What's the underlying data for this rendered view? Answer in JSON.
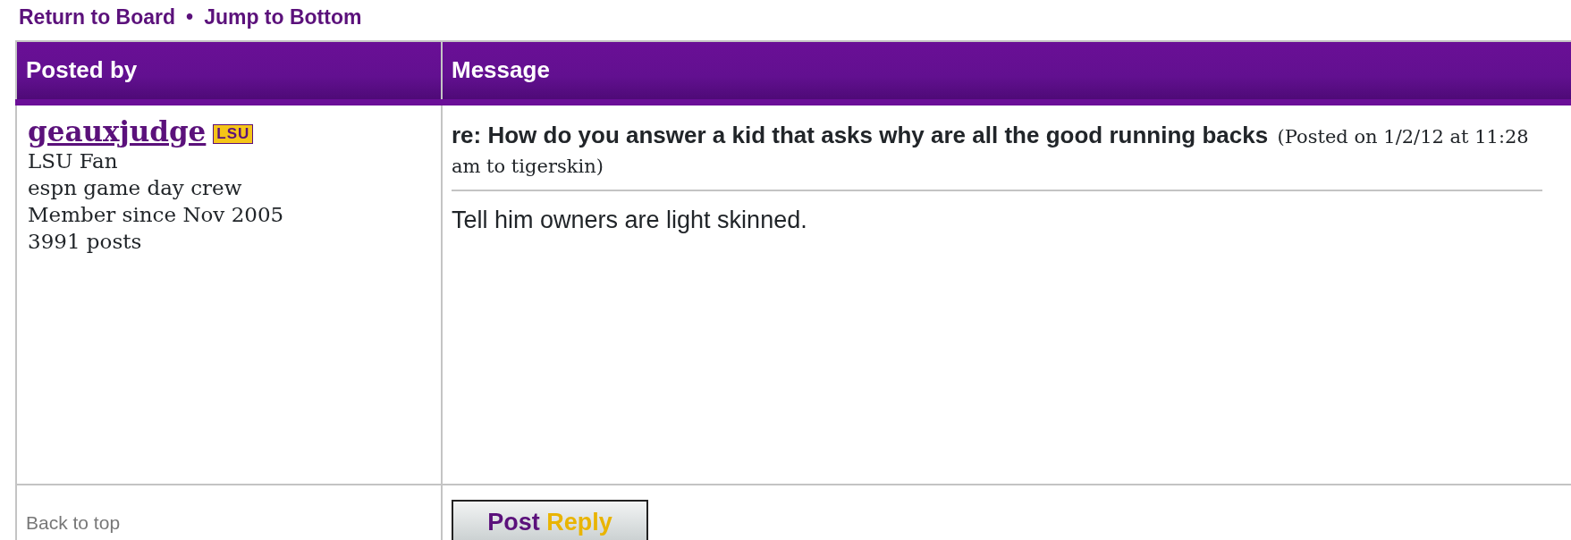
{
  "nav_links": [
    "Return to Board",
    "Jump to Bottom"
  ],
  "nav_separator": "•",
  "columns": [
    "Posted by",
    "Message"
  ],
  "post": {
    "author": "geauxjudge",
    "team_badge": "LSU",
    "author_lines": [
      "LSU Fan",
      "espn game day crew",
      "Member since Nov 2005",
      "3991 posts"
    ],
    "title": "re: How do you answer a kid that asks why are all the good running backs",
    "meta": "(Posted on 1/2/12 at 11:28 am to tigerskin)",
    "body": "Tell him owners are light skinned."
  },
  "back_to_top": "Back to top",
  "reply_button": [
    "Post",
    "Reply"
  ]
}
